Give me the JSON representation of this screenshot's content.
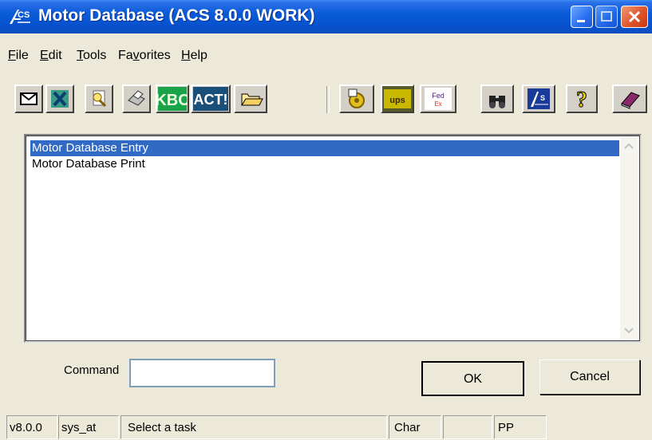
{
  "window": {
    "title": "Motor Database (ACS 8.0.0 WORK)",
    "colors": {
      "titlebar": "#0a5bd8",
      "face": "#ece9d8",
      "selection": "#316ac5"
    }
  },
  "menu": [
    {
      "label": "File"
    },
    {
      "label": "Edit"
    },
    {
      "label": "Tools"
    },
    {
      "label": "Favorites"
    },
    {
      "label": "Help"
    }
  ],
  "toolbar": {
    "buttons": [
      {
        "icon": "envelope-icon"
      },
      {
        "icon": "excel-icon"
      },
      {
        "icon": "search-document-icon"
      },
      {
        "icon": "printer-icon"
      },
      {
        "icon": "kbd-icon",
        "text": "KBC"
      },
      {
        "icon": "act-icon",
        "text": "ACT!"
      },
      {
        "icon": "open-folder-icon"
      },
      {
        "icon": "settings-gear-icon"
      },
      {
        "icon": "ups-icon",
        "text": "ups"
      },
      {
        "icon": "fedex-icon",
        "text": "Fed Ex"
      },
      {
        "icon": "binoculars-icon"
      },
      {
        "icon": "acs-logo-icon"
      },
      {
        "icon": "help-icon",
        "text": "?"
      },
      {
        "icon": "book-icon"
      }
    ]
  },
  "list": {
    "items": [
      {
        "label": "Motor Database Entry",
        "selected": true
      },
      {
        "label": "Motor Database Print",
        "selected": false
      }
    ]
  },
  "command": {
    "label": "Command",
    "value": ""
  },
  "buttons": {
    "ok": "OK",
    "cancel": "Cancel"
  },
  "status": {
    "version": "v8.0.0",
    "user": "sys_at",
    "message": "Select a task",
    "mode": "Char",
    "extra": "",
    "code": "PP"
  }
}
